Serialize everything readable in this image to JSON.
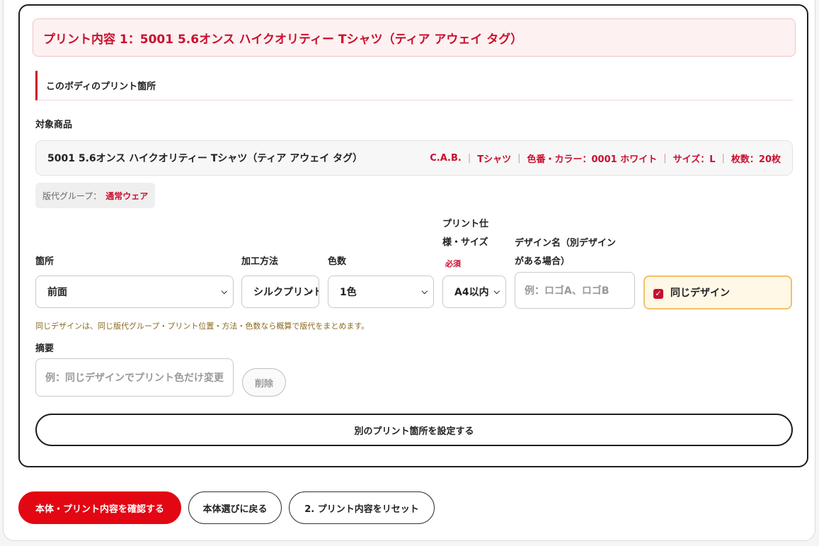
{
  "print_block": {
    "header": "プリント内容 1：5001 5.6オンス ハイクオリティー Tシャツ（ティア アウェイ タグ）",
    "section_title": "このボディのプリント箇所",
    "target_label": "対象商品",
    "product": {
      "name": "5001 5.6オンス ハイクオリティー Tシャツ（ティア アウェイ タグ）",
      "brand": "C.A.B.",
      "category": "Tシャツ",
      "color": "色番・カラー：0001 ホワイト",
      "size": "サイズ：L",
      "quantity": "枚数：20枚"
    },
    "group": {
      "label": "版代グループ：",
      "value": "通常ウェア"
    },
    "fields": {
      "location": {
        "label": "箇所",
        "value": "前面"
      },
      "method": {
        "label": "加工方法",
        "value": "シルクプリント"
      },
      "colors": {
        "label": "色数",
        "value": "1色"
      },
      "spec": {
        "label_line1": "プリント仕",
        "label_line2": "様・サイズ",
        "required": "必須",
        "value": "A4以内"
      },
      "design_name": {
        "label_line1": "デザイン名（別デザイン",
        "label_line2": "がある場合）",
        "placeholder": "例：ロゴA、ロゴB"
      },
      "same_design": {
        "label": "同じデザイン",
        "checked": true
      }
    },
    "note": "同じデザインは、同じ版代グループ・プリント位置・方法・色数なら概算で版代をまとめます。",
    "summary": {
      "label": "摘要",
      "placeholder": "例：同じデザインでプリント色だけ変更"
    },
    "delete_label": "削除",
    "add_location_label": "別のプリント箇所を設定する"
  },
  "actions": {
    "confirm": "本体・プリント内容を確認する",
    "back": "本体選びに戻る",
    "reset": "2. プリント内容をリセット"
  },
  "colors": {
    "accent": "#c8102e",
    "primary_button": "#e30613",
    "highlight_border": "#f0c26a"
  }
}
